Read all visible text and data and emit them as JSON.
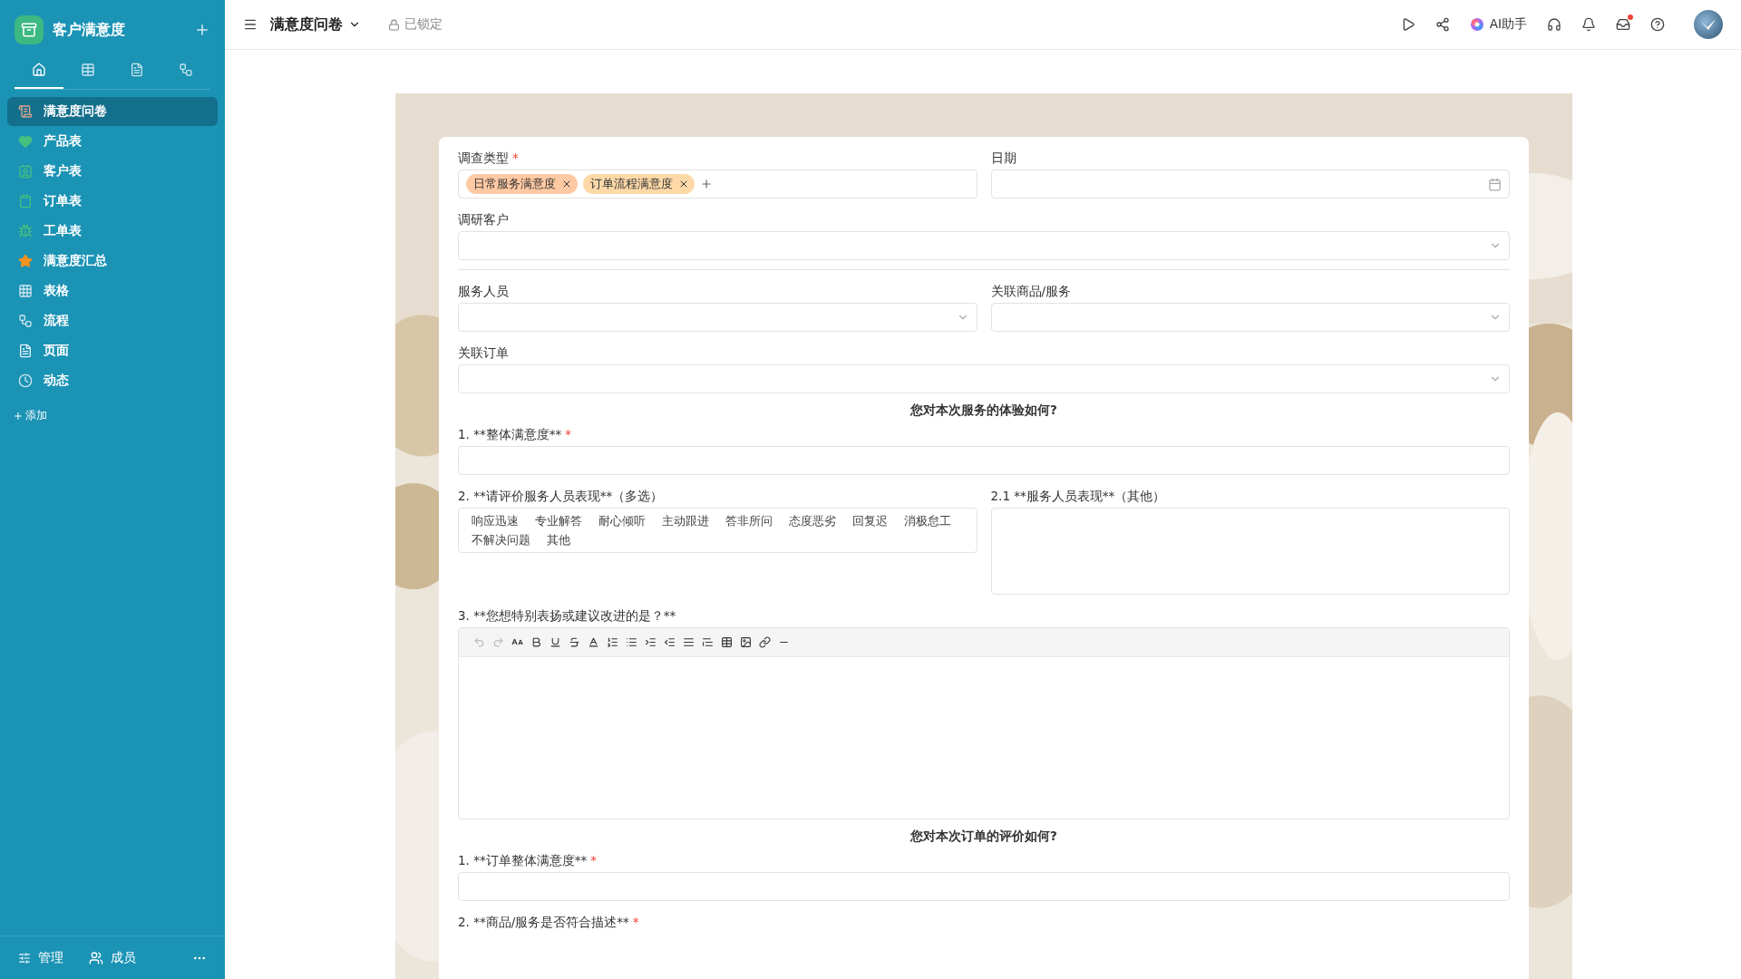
{
  "sidebar": {
    "app_title": "客户满意度",
    "tabs": [
      {
        "kind": "home",
        "selected": true
      },
      {
        "kind": "table",
        "selected": false
      },
      {
        "kind": "doc",
        "selected": false
      },
      {
        "kind": "flow",
        "selected": false
      }
    ],
    "items": [
      {
        "label": "满意度问卷",
        "kind": "scroll",
        "selected": true
      },
      {
        "label": "产品表",
        "kind": "heart",
        "selected": false
      },
      {
        "label": "客户表",
        "kind": "contact",
        "selected": false
      },
      {
        "label": "订单表",
        "kind": "clipboard",
        "selected": false
      },
      {
        "label": "工单表",
        "kind": "bug",
        "selected": false
      },
      {
        "label": "满意度汇总",
        "kind": "star",
        "selected": false
      },
      {
        "label": "表格",
        "kind": "grid",
        "selected": false
      },
      {
        "label": "流程",
        "kind": "flow",
        "selected": false
      },
      {
        "label": "页面",
        "kind": "page",
        "selected": false
      },
      {
        "label": "动态",
        "kind": "clock",
        "selected": false
      }
    ],
    "add_label": "添加",
    "footer": [
      {
        "label": "管理",
        "kind": "sliders"
      },
      {
        "label": "成员",
        "kind": "users"
      }
    ]
  },
  "topbar": {
    "title": "满意度问卷",
    "lock_label": "已锁定",
    "ai_label": "AI助手",
    "has_notification": true
  },
  "form": {
    "rows": [
      {
        "kind": "fields",
        "fields": [
          {
            "label": "调查类型",
            "required_mark": "*",
            "kind": "tags",
            "tags": [
              {
                "label": "日常服务满意度",
                "color": "#ffc9a3"
              },
              {
                "label": "订单流程满意度",
                "color": "#fdd9a8"
              }
            ]
          },
          {
            "label": "日期",
            "kind": "date"
          }
        ]
      },
      {
        "kind": "fields",
        "fields": [
          {
            "label": "调研客户",
            "kind": "select"
          }
        ]
      },
      {
        "kind": "divider"
      },
      {
        "kind": "fields",
        "fields": [
          {
            "label": "服务人员",
            "kind": "select"
          },
          {
            "label": "关联商品/服务",
            "kind": "select"
          }
        ]
      },
      {
        "kind": "fields",
        "fields": [
          {
            "label": "关联订单",
            "kind": "select"
          }
        ]
      },
      {
        "kind": "heading",
        "text": "您对本次服务的体验如何?"
      },
      {
        "kind": "fields",
        "fields": [
          {
            "label": "1. **整体满意度**",
            "required_mark": "*",
            "kind": "text"
          }
        ]
      },
      {
        "kind": "fields",
        "fields": [
          {
            "label": "2. **请评价服务人员表现**（多选）",
            "kind": "options",
            "options": [
              "响应迅速",
              "专业解答",
              "耐心倾听",
              "主动跟进",
              "答非所问",
              "态度恶劣",
              "回复迟",
              "消极怠工",
              "不解决问题",
              "其他"
            ]
          },
          {
            "label": "2.1 **服务人员表现**（其他）",
            "kind": "textarea"
          }
        ]
      },
      {
        "kind": "fields",
        "fields": [
          {
            "label": "3. **您想特别表扬或建议改进的是？**",
            "kind": "richtext"
          }
        ]
      },
      {
        "kind": "heading",
        "text": "您对本次订单的评价如何?"
      },
      {
        "kind": "fields",
        "fields": [
          {
            "label": "1. **订单整体满意度**",
            "required_mark": "*",
            "kind": "text"
          }
        ]
      },
      {
        "kind": "fields",
        "fields": [
          {
            "label": "2. **商品/服务是否符合描述**",
            "required_mark": "*",
            "kind": "label_only"
          }
        ]
      }
    ]
  }
}
